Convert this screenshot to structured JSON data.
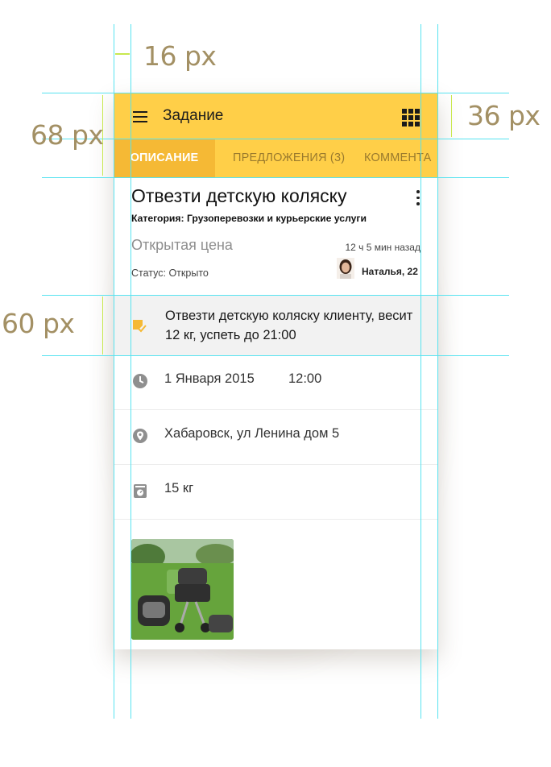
{
  "annotations": {
    "margin": "16 px",
    "toolbar_height": "36 px",
    "appbar_height": "68 px",
    "row_height": "60 px"
  },
  "appbar": {
    "title": "Задание",
    "menu_icon": "hamburger-icon",
    "apps_icon": "grid-icon"
  },
  "tabs": [
    {
      "label": "ОПИСАНИЕ",
      "active": true
    },
    {
      "label": "ПРЕДЛОЖЕНИЯ (3)",
      "active": false
    },
    {
      "label": "КОММЕНТА",
      "active": false
    }
  ],
  "task": {
    "title": "Отвезти детскую коляску",
    "category": "Категория: Грузоперевозки и курьерские услуги",
    "price": "Открытая цена",
    "time_ago": "12 ч 5 мин назад",
    "status": "Статус: Открыто",
    "user": "Наталья, 22"
  },
  "description": "Отвезти детскую коляску клиенту, весит 12 кг, успеть до 21:00",
  "details": {
    "date": "1 Января 2015",
    "time": "12:00",
    "address": "Хабаровск, ул Ленина дом 5",
    "weight": "15 кг"
  },
  "colors": {
    "primary": "#FFCF48",
    "tab_active": "#F5B935",
    "guide": "#58E3F0",
    "dimension": "#C8E84E",
    "label": "#A39064"
  }
}
